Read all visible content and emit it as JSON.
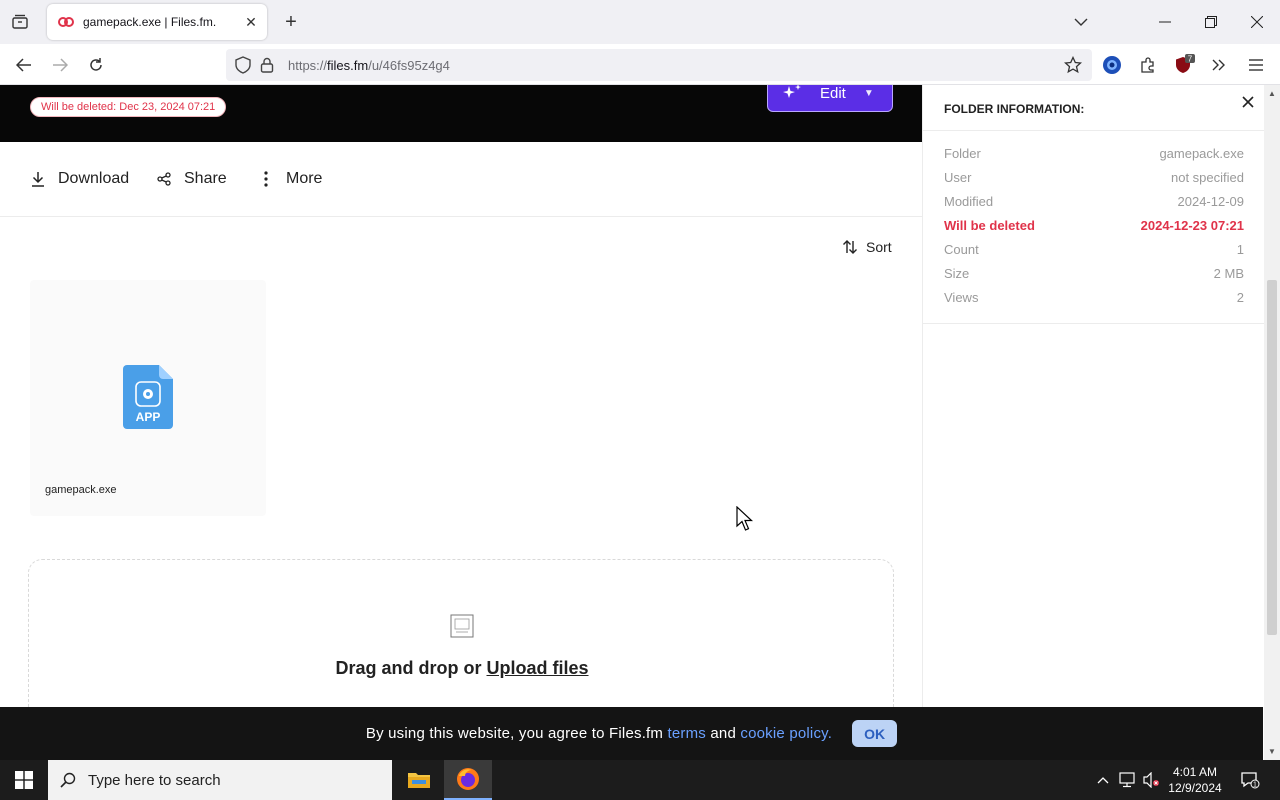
{
  "browser": {
    "tab_title": "gamepack.exe | Files.fm.",
    "url_prefix": "https://",
    "url_domain": "files.fm",
    "url_path": "/u/46fs95z4g4",
    "extension_badge": "7"
  },
  "hero": {
    "deletion_notice": "Will be deleted: Dec 23, 2024 07:21",
    "edit_label": "Edit"
  },
  "actions": {
    "download": "Download",
    "share": "Share",
    "more": "More",
    "sort": "Sort"
  },
  "file": {
    "name": "gamepack.exe",
    "icon_label": "APP"
  },
  "dropzone": {
    "text": "Drag and drop or",
    "link": "Upload files"
  },
  "panel": {
    "title": "FOLDER INFORMATION:",
    "rows": [
      {
        "label": "Folder",
        "value": "gamepack.exe"
      },
      {
        "label": "User",
        "value": "not specified"
      },
      {
        "label": "Modified",
        "value": "2024-12-09"
      },
      {
        "label": "Will be deleted",
        "value": "2024-12-23 07:21"
      },
      {
        "label": "Count",
        "value": "1"
      },
      {
        "label": "Size",
        "value": "2 MB"
      },
      {
        "label": "Views",
        "value": "2"
      }
    ]
  },
  "cookie": {
    "text_before": "By using this website, you agree to Files.fm",
    "terms": "terms",
    "and": "and",
    "policy": "cookie policy.",
    "ok": "OK"
  },
  "taskbar": {
    "search_placeholder": "Type here to search",
    "time": "4:01 AM",
    "date": "12/9/2024",
    "notification_count": "1"
  },
  "colors": {
    "accent": "#5b2ee6",
    "danger": "#e0334a",
    "link": "#6aa0ff"
  }
}
